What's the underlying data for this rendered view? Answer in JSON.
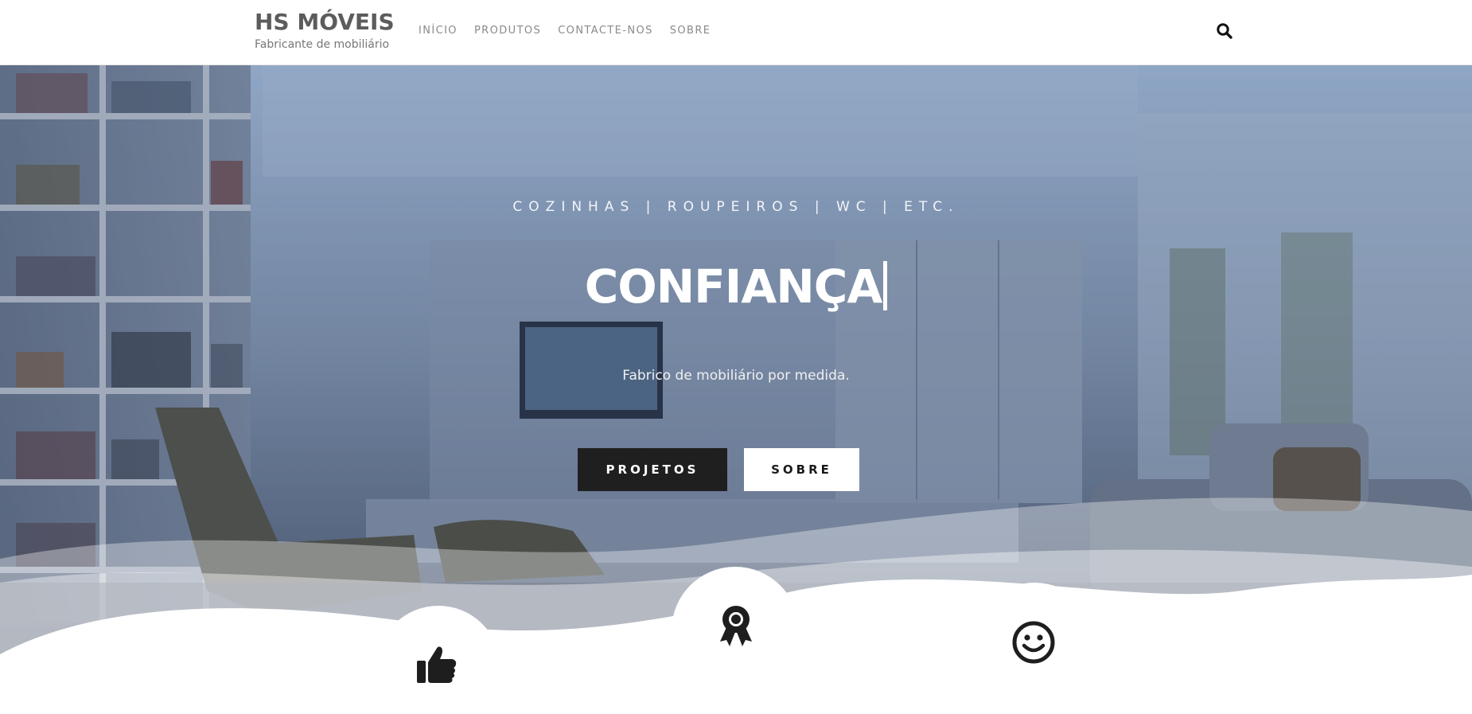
{
  "brand": {
    "title": "HS MÓVEIS",
    "subtitle": "Fabricante de mobiliário"
  },
  "nav": {
    "items": [
      {
        "label": "INÍCIO"
      },
      {
        "label": "PRODUTOS"
      },
      {
        "label": "CONTACTE-NOS"
      },
      {
        "label": "SOBRE"
      }
    ],
    "search_icon": "search-icon"
  },
  "hero": {
    "subtitle": "COZINHAS | ROUPEIROS | WC | ETC.",
    "title": "CONFIANÇA",
    "text": "Fabrico de mobiliário por medida.",
    "primary_button": "PROJETOS",
    "secondary_button": "SOBRE"
  },
  "features": {
    "icons": [
      "thumbs-up-icon",
      "award-ribbon-icon",
      "smile-icon"
    ]
  },
  "colors": {
    "brand_text": "#5c5c5c",
    "nav_text": "#8a8a8a",
    "button_dark": "#1f1f1f",
    "button_light": "#ffffff"
  }
}
